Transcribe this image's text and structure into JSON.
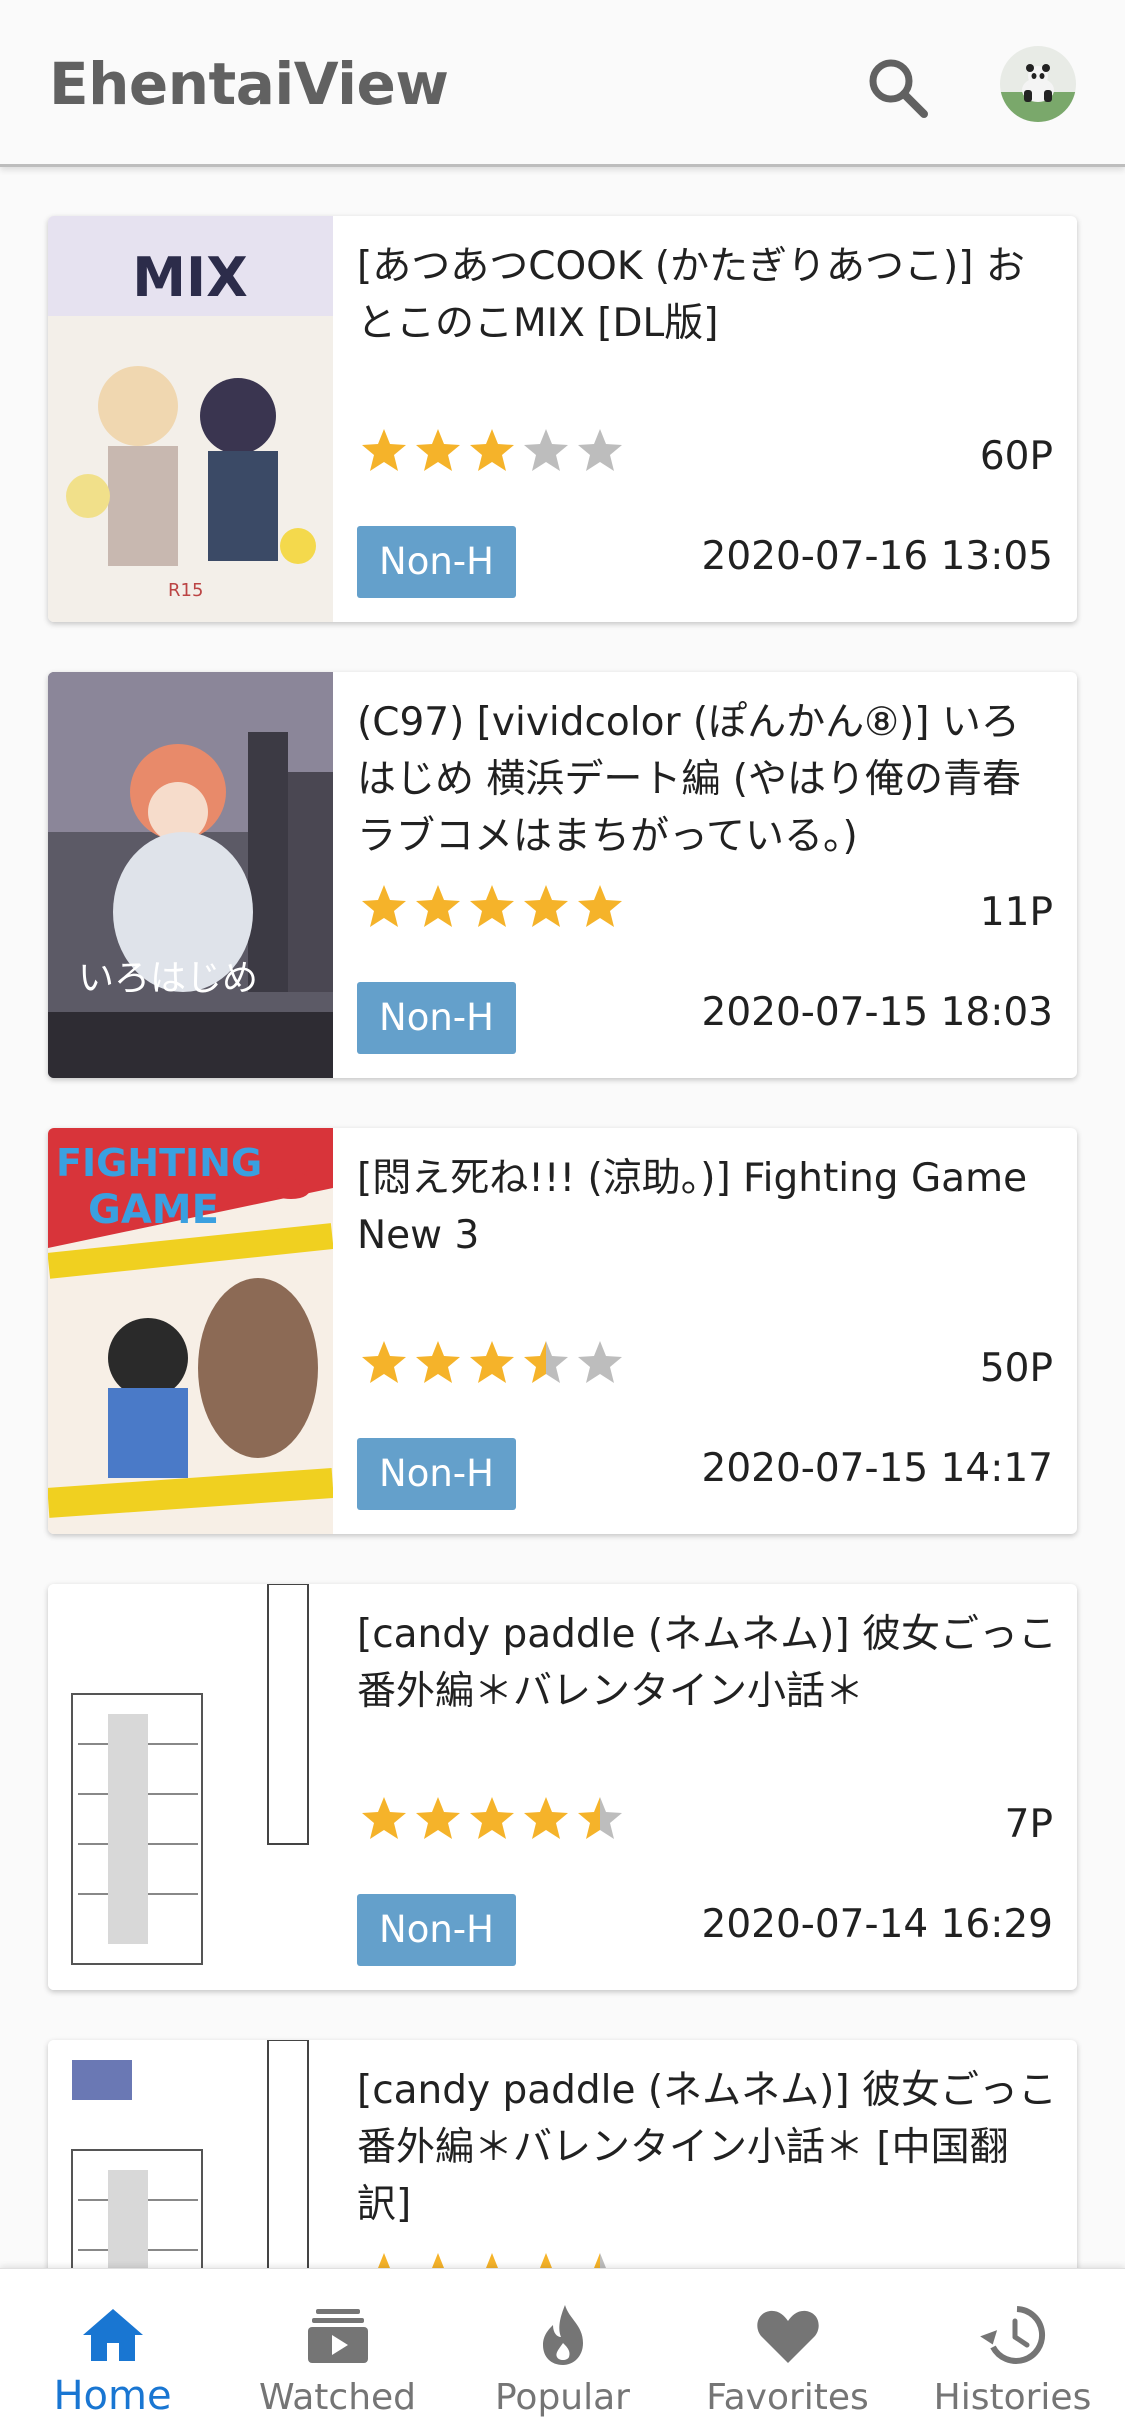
{
  "app": {
    "title": "EhentaiView"
  },
  "icons": {
    "search": "search-icon",
    "avatar": "panda-avatar"
  },
  "colors": {
    "star": "#f5b32a",
    "star_empty": "#bdbdbd",
    "badge": "#64a0cb",
    "active_nav": "#1976d2",
    "inactive_nav": "#757575"
  },
  "items": [
    {
      "title": "[あつあつCOOK (かたぎりあつこ)] おとこのこMIX [DL版]",
      "rating": 3,
      "pages": "60P",
      "category": "Non-H",
      "date": "2020-07-16 13:05"
    },
    {
      "title": "(C97) [vividcolor (ぽんかん⑧)] いろはじめ 横浜デート編 (やはり俺の青春ラブコメはまちがっている。)",
      "rating": 5,
      "pages": "11P",
      "category": "Non-H",
      "date": "2020-07-15 18:03"
    },
    {
      "title": "[悶え死ね!!! (涼助。)] Fighting Game New 3",
      "rating": 3.5,
      "pages": "50P",
      "category": "Non-H",
      "date": "2020-07-15 14:17"
    },
    {
      "title": "[candy paddle (ネムネム)] 彼女ごっこ 番外編＊バレンタイン小話＊",
      "rating": 4.5,
      "pages": "7P",
      "category": "Non-H",
      "date": "2020-07-14 16:29"
    },
    {
      "title": "[candy paddle (ネムネム)] 彼女ごっこ 番外編＊バレンタイン小話＊ [中国翻訳]",
      "rating": 4.5,
      "pages": "",
      "category": "",
      "date": ""
    }
  ],
  "bottom_nav": [
    {
      "label": "Home",
      "icon": "home-icon",
      "active": true
    },
    {
      "label": "Watched",
      "icon": "watched-icon",
      "active": false
    },
    {
      "label": "Popular",
      "icon": "flame-icon",
      "active": false
    },
    {
      "label": "Favorites",
      "icon": "heart-icon",
      "active": false
    },
    {
      "label": "Histories",
      "icon": "history-icon",
      "active": false
    }
  ]
}
